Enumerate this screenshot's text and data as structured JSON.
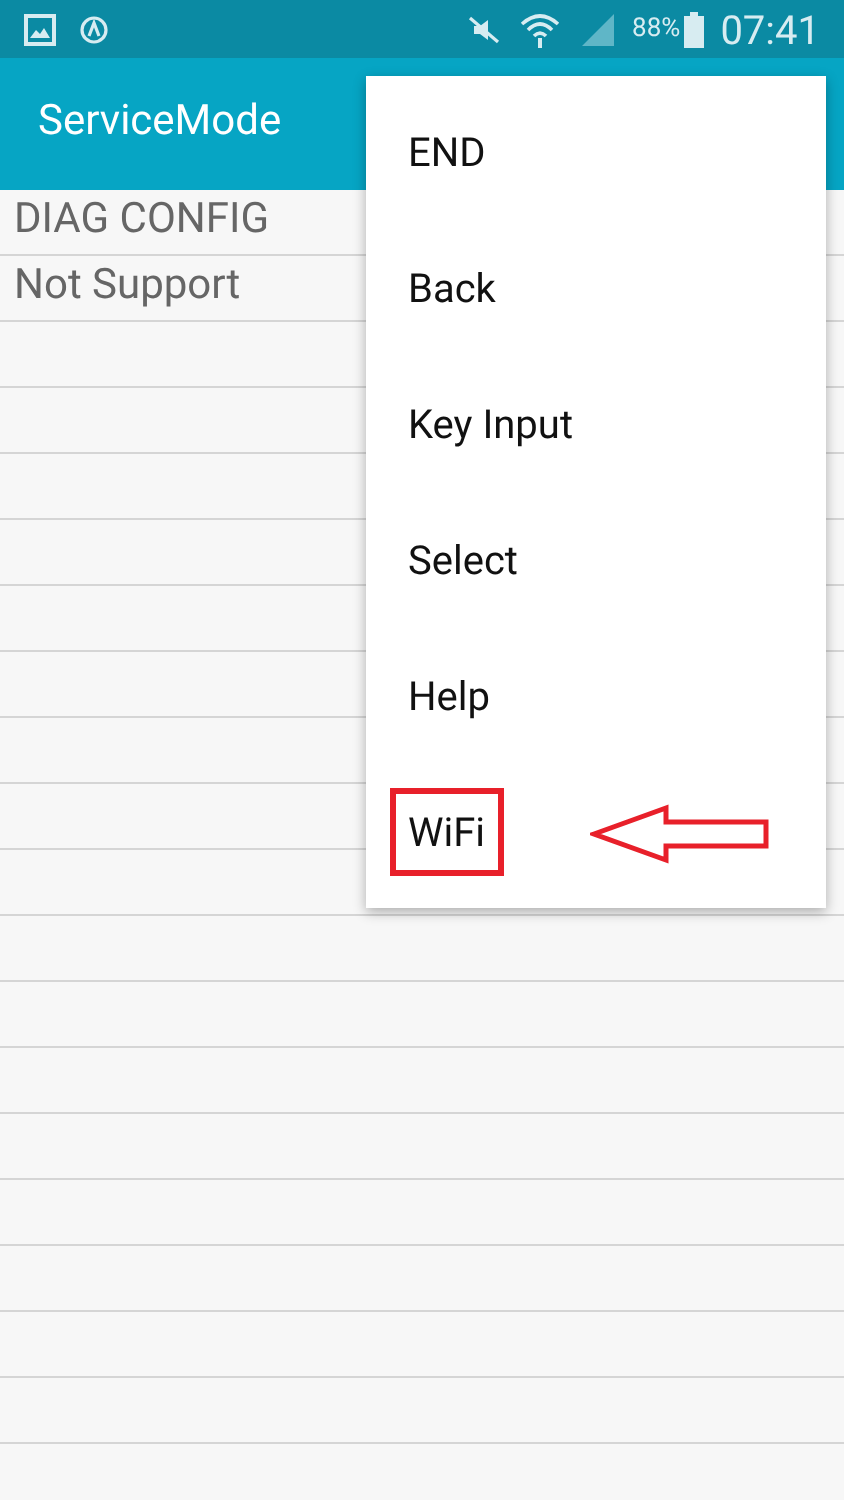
{
  "status_bar": {
    "battery": "88%",
    "time": "07:41"
  },
  "app_bar": {
    "title": "ServiceMode"
  },
  "rows": [
    "DIAG CONFIG",
    "Not Support"
  ],
  "menu": [
    {
      "label": "END",
      "annotated": false
    },
    {
      "label": "Back",
      "annotated": false
    },
    {
      "label": "Key Input",
      "annotated": false
    },
    {
      "label": "Select",
      "annotated": false
    },
    {
      "label": "Help",
      "annotated": false
    },
    {
      "label": "WiFi",
      "annotated": true
    }
  ]
}
